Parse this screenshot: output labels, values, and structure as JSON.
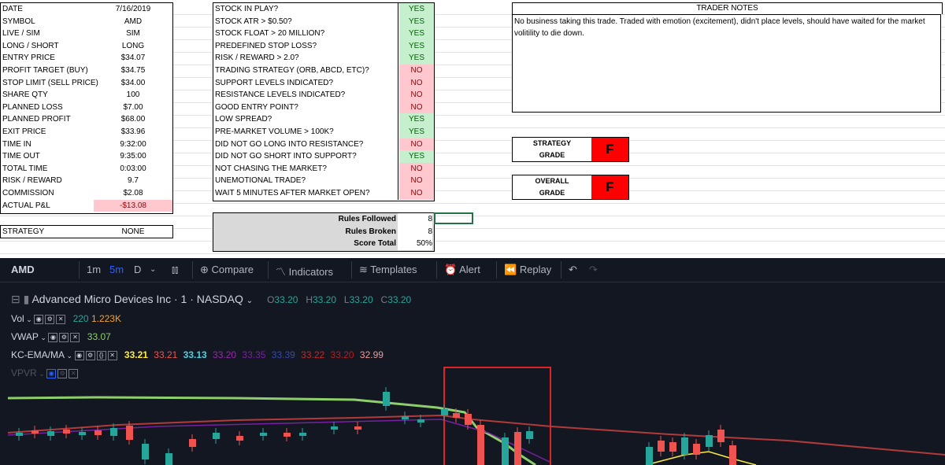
{
  "trade_details": [
    {
      "label": "DATE",
      "value": "7/16/2019",
      "style": ""
    },
    {
      "label": "SYMBOL",
      "value": "AMD",
      "style": ""
    },
    {
      "label": "LIVE / SIM",
      "value": "SIM",
      "style": ""
    },
    {
      "label": "LONG / SHORT",
      "value": "LONG",
      "style": ""
    },
    {
      "label": "ENTRY PRICE",
      "value": "$34.07",
      "style": ""
    },
    {
      "label": "PROFIT TARGET (BUY)",
      "value": "$34.75",
      "style": ""
    },
    {
      "label": "STOP LIMIT (SELL PRICE)",
      "value": "$34.00",
      "style": ""
    },
    {
      "label": "SHARE QTY",
      "value": "100",
      "style": ""
    },
    {
      "label": "PLANNED LOSS",
      "value": "$7.00",
      "style": ""
    },
    {
      "label": "PLANNED PROFIT",
      "value": "$68.00",
      "style": ""
    },
    {
      "label": "EXIT PRICE",
      "value": "$33.96",
      "style": ""
    },
    {
      "label": "TIME IN",
      "value": "9:32:00",
      "style": ""
    },
    {
      "label": "TIME OUT",
      "value": "9:35:00",
      "style": ""
    },
    {
      "label": "TOTAL TIME",
      "value": "0:03:00",
      "style": ""
    },
    {
      "label": "RISK / REWARD",
      "value": "9.7",
      "style": ""
    },
    {
      "label": "COMMISSION",
      "value": "$2.08",
      "style": ""
    },
    {
      "label": "ACTUAL P&L",
      "value": "-$13.08",
      "style": "neg"
    }
  ],
  "strategy": {
    "label": "STRATEGY",
    "value": "NONE"
  },
  "rules": [
    {
      "text": "STOCK IN PLAY?",
      "answer": "YES"
    },
    {
      "text": "STOCK ATR > $0.50?",
      "answer": "YES"
    },
    {
      "text": "STOCK FLOAT > 20 MILLION?",
      "answer": "YES"
    },
    {
      "text": "PREDEFINED STOP LOSS?",
      "answer": "YES"
    },
    {
      "text": "RISK / REWARD > 2.0?",
      "answer": "YES"
    },
    {
      "text": "TRADING STRATEGY (ORB, ABCD, ETC)?",
      "answer": "NO"
    },
    {
      "text": "SUPPORT LEVELS INDICATED?",
      "answer": "NO"
    },
    {
      "text": "RESISTANCE LEVELS INDICATED?",
      "answer": "NO"
    },
    {
      "text": "GOOD ENTRY POINT?",
      "answer": "NO"
    },
    {
      "text": "LOW SPREAD?",
      "answer": "YES"
    },
    {
      "text": "PRE-MARKET VOLUME > 100K?",
      "answer": "YES"
    },
    {
      "text": "DID NOT GO LONG INTO RESISTANCE?",
      "answer": "NO"
    },
    {
      "text": "DID NOT GO SHORT INTO SUPPORT?",
      "answer": "YES"
    },
    {
      "text": "NOT CHASING THE MARKET?",
      "answer": "NO"
    },
    {
      "text": "UNEMOTIONAL TRADE?",
      "answer": "NO"
    },
    {
      "text": "WAIT 5 MINUTES AFTER MARKET OPEN?",
      "answer": "NO"
    }
  ],
  "score": {
    "followed_label": "Rules Followed",
    "followed": "8",
    "broken_label": "Rules Broken",
    "broken": "8",
    "total_label": "Score Total",
    "total": "50%"
  },
  "notes": {
    "title": "TRADER NOTES",
    "text": "No business taking this trade. Traded with emotion (excitement), didn't place levels, should have waited for the market volitility to die down."
  },
  "grades": {
    "strategy": {
      "line1": "STRATEGY",
      "line2": "GRADE",
      "value": "F"
    },
    "overall": {
      "line1": "OVERALL",
      "line2": "GRADE",
      "value": "F"
    }
  },
  "chart_ui": {
    "symbol": "AMD",
    "intervals": [
      "1m",
      "5m",
      "D"
    ],
    "compare": "Compare",
    "indicators": "Indicators",
    "templates": "Templates",
    "alert": "Alert",
    "replay": "Replay",
    "title": "Advanced Micro Devices Inc · 1 · NASDAQ",
    "ohlc": {
      "o": "33.20",
      "h": "33.20",
      "l": "33.20",
      "c": "33.20"
    },
    "vol": {
      "label": "Vol",
      "v1": "220",
      "v2": "1.223K"
    },
    "vwap": {
      "label": "VWAP",
      "value": "33.07"
    },
    "kc": {
      "label": "KC-EMA/MA",
      "values": [
        "33.21",
        "33.21",
        "33.13",
        "33.20",
        "33.35",
        "33.39",
        "33.22",
        "33.20",
        "32.99"
      ]
    },
    "vpvr": {
      "label": "VPVR"
    },
    "colors": {
      "up": "#26a69a",
      "down": "#ef5350",
      "bg": "#131722",
      "vwap": "#8ecf6b",
      "box": "#e02424"
    }
  }
}
